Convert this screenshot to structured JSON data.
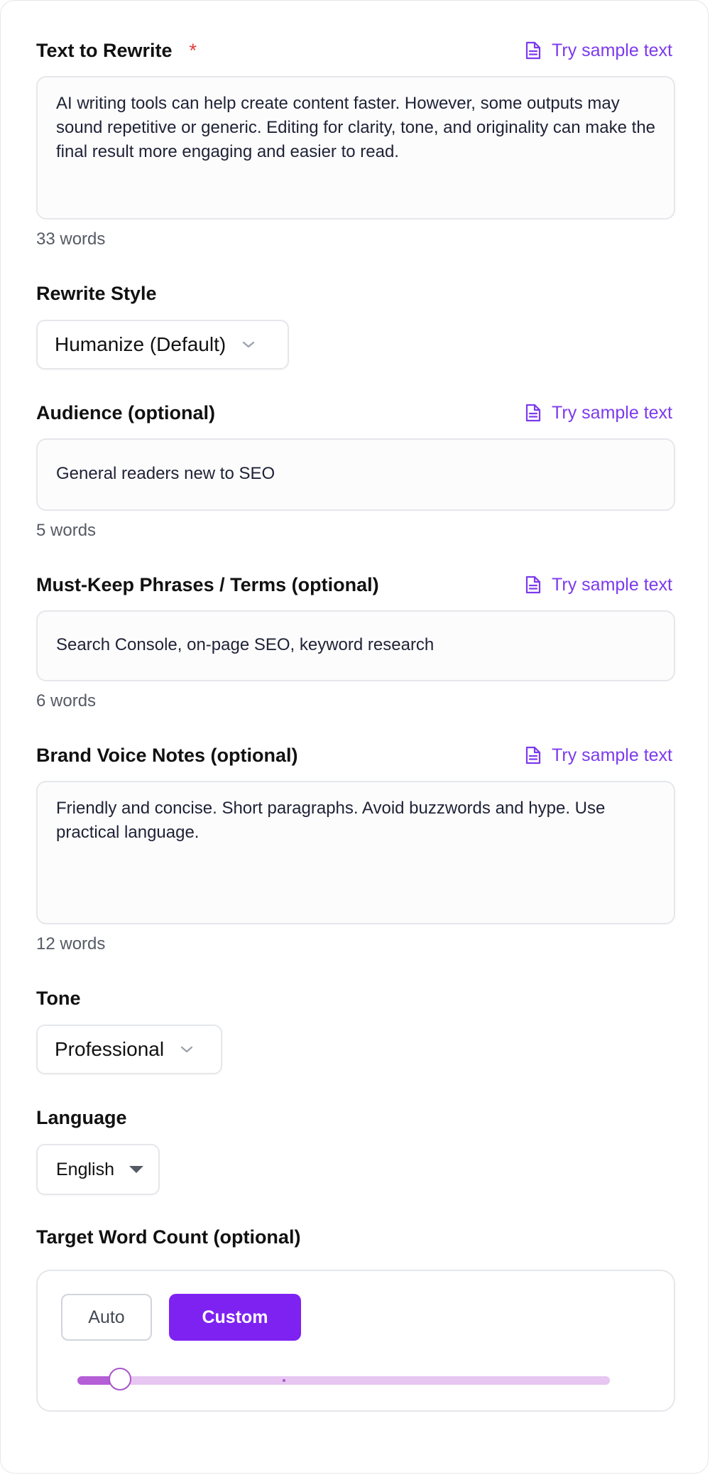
{
  "text_to_rewrite": {
    "label": "Text to Rewrite",
    "required_marker": "*",
    "sample_link": "Try sample text",
    "value": "AI writing tools can help create content faster. However, some outputs may sound repetitive or generic. Editing for clarity, tone, and originality can make the final result more engaging and easier to read.",
    "word_count": "33 words"
  },
  "rewrite_style": {
    "label": "Rewrite Style",
    "selected": "Humanize (Default)"
  },
  "audience": {
    "label": "Audience (optional)",
    "sample_link": "Try sample text",
    "value": "General readers new to SEO",
    "word_count": "5 words"
  },
  "must_keep": {
    "label": "Must-Keep Phrases / Terms (optional)",
    "sample_link": "Try sample text",
    "value": "Search Console, on-page SEO, keyword research",
    "word_count": "6 words"
  },
  "brand_voice": {
    "label": "Brand Voice Notes (optional)",
    "sample_link": "Try sample text",
    "value": "Friendly and concise. Short paragraphs. Avoid buzzwords and hype. Use practical language.",
    "word_count": "12 words"
  },
  "tone": {
    "label": "Tone",
    "selected": "Professional"
  },
  "language": {
    "label": "Language",
    "selected": "English"
  },
  "target_word_count": {
    "label": "Target Word Count (optional)",
    "auto_label": "Auto",
    "custom_label": "Custom",
    "active_mode": "Custom",
    "slider_fraction": 0.08
  },
  "colors": {
    "accent": "#7e22f2",
    "link": "#7c3aed",
    "required": "#e53935"
  }
}
